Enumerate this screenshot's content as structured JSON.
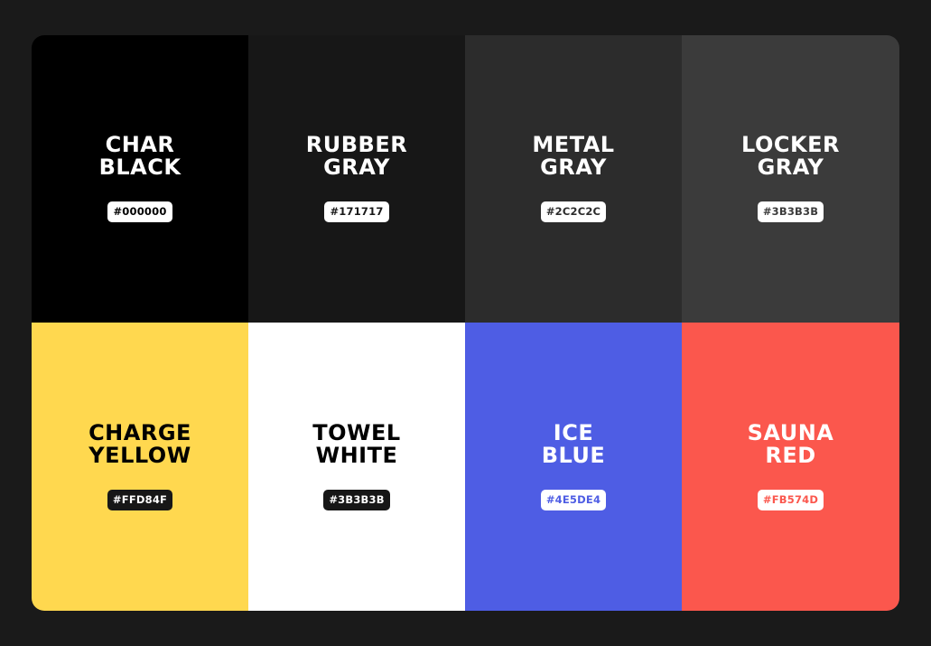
{
  "swatches": [
    {
      "line1": "CHAR",
      "line2": "BLACK",
      "hex": "#000000",
      "bg": "#000000",
      "text_color": "#FFFFFF",
      "badge_bg": "#FFFFFF",
      "badge_text": "#000000"
    },
    {
      "line1": "RUBBER",
      "line2": "GRAY",
      "hex": "#171717",
      "bg": "#171717",
      "text_color": "#FFFFFF",
      "badge_bg": "#FFFFFF",
      "badge_text": "#171717"
    },
    {
      "line1": "METAL",
      "line2": "GRAY",
      "hex": "#2C2C2C",
      "bg": "#2C2C2C",
      "text_color": "#FFFFFF",
      "badge_bg": "#FFFFFF",
      "badge_text": "#2C2C2C"
    },
    {
      "line1": "LOCKER",
      "line2": "GRAY",
      "hex": "#3B3B3B",
      "bg": "#3B3B3B",
      "text_color": "#FFFFFF",
      "badge_bg": "#FFFFFF",
      "badge_text": "#3B3B3B"
    },
    {
      "line1": "CHARGE",
      "line2": "YELLOW",
      "hex": "#FFD84F",
      "bg": "#FFD84F",
      "text_color": "#000000",
      "badge_bg": "#171717",
      "badge_text": "#FFFFFF"
    },
    {
      "line1": "TOWEL",
      "line2": "WHITE",
      "hex": "#3B3B3B",
      "bg": "#FFFFFF",
      "text_color": "#000000",
      "badge_bg": "#171717",
      "badge_text": "#FFFFFF"
    },
    {
      "line1": "ICE",
      "line2": "BLUE",
      "hex": "#4E5DE4",
      "bg": "#4E5DE4",
      "text_color": "#FFFFFF",
      "badge_bg": "#FFFFFF",
      "badge_text": "#4E5DE4"
    },
    {
      "line1": "SAUNA",
      "line2": "RED",
      "hex": "#FB574D",
      "bg": "#FB574D",
      "text_color": "#FFFFFF",
      "badge_bg": "#FFFFFF",
      "badge_text": "#FB574D"
    }
  ]
}
